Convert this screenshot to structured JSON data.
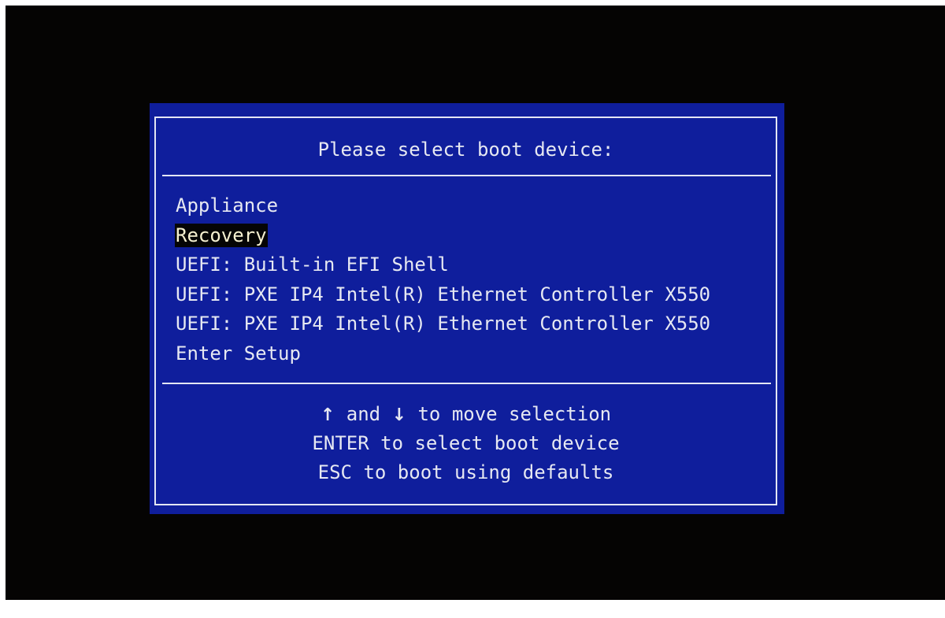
{
  "boot_menu": {
    "title": "Please select boot device:",
    "selected_index": 1,
    "items": [
      {
        "label": "Appliance"
      },
      {
        "label": "Recovery"
      },
      {
        "label": "UEFI: Built-in EFI Shell"
      },
      {
        "label": "UEFI: PXE IP4 Intel(R) Ethernet Controller X550"
      },
      {
        "label": "UEFI: PXE IP4 Intel(R) Ethernet Controller X550"
      },
      {
        "label": "Enter Setup"
      }
    ]
  },
  "help": {
    "line1": {
      "up_arrow": "↑",
      "and_text": " and ",
      "down_arrow": "↓",
      "rest": " to move selection"
    },
    "line2": "ENTER to select boot device",
    "line3": "ESC to boot using defaults"
  },
  "colors": {
    "screen_background": "#050403",
    "panel_background": "#0f1e9c",
    "text": "#e6e8f2",
    "selection_background": "#050505"
  }
}
